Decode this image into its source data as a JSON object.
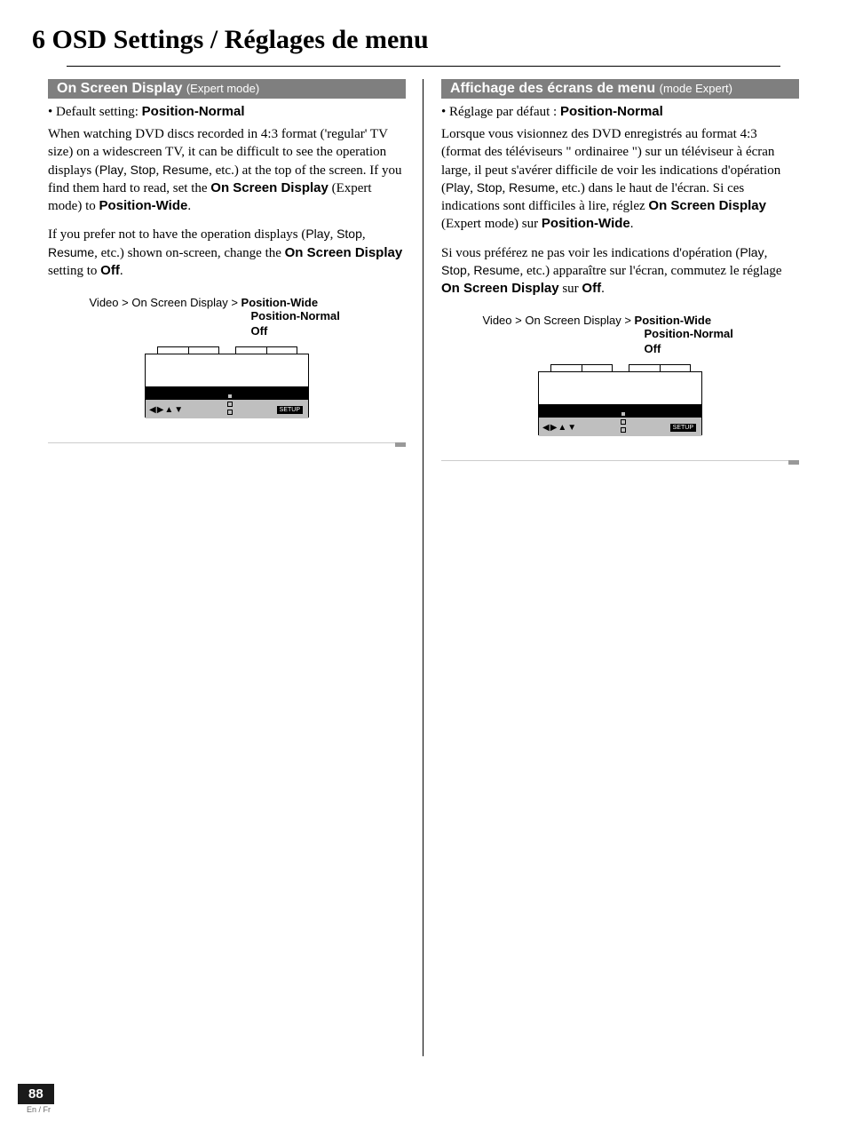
{
  "chapter": "6 OSD Settings / Réglages de menu",
  "en": {
    "bar_main": "On Screen Display",
    "bar_suffix": "(Expert mode)",
    "default_prefix": "• Default setting: ",
    "default_value": "Position-Normal",
    "p1a": "When watching DVD discs recorded in 4:3 format ('regular' TV size) on a widescreen TV, it can be difficult to see the operation displays (",
    "p1_play": "Play",
    "p1b": ", ",
    "p1_stop": "Stop",
    "p1c": ", ",
    "p1_resume": "Resume",
    "p1d": ", etc.) at the top of the screen. If you find them hard to read, set the ",
    "p1_osd": "On Screen Display",
    "p1e": " (Expert mode) to ",
    "p1_pw": "Position-Wide",
    "p1f": ".",
    "p2a": "If you prefer not to have the operation displays (",
    "p2_play": "Play",
    "p2b": ", ",
    "p2_stop": "Stop",
    "p2c": ", ",
    "p2_resume": "Resume",
    "p2d": ", etc.) shown on-screen, change the ",
    "p2_osd": "On Screen Display",
    "p2e": " setting to ",
    "p2_off": "Off",
    "p2f": ".",
    "fig_path_pre": "Video > On Screen Display > ",
    "fig_opt1": "Position-Wide",
    "fig_opt2": "Position-Normal",
    "fig_opt3": "Off",
    "fig_setup": "SETUP"
  },
  "fr": {
    "bar_main": "Affichage des écrans de menu",
    "bar_suffix": "(mode Expert)",
    "default_prefix": "• Réglage par défaut : ",
    "default_value": "Position-Normal",
    "p1a": "Lorsque vous visionnez des DVD enregistrés au format 4:3 (format des téléviseurs \" ordinairee \") sur un téléviseur à écran large, il peut s'avérer difficile de voir les indications d'opération (",
    "p1_play": "Play",
    "p1b": ", ",
    "p1_stop": "Stop",
    "p1c": ", ",
    "p1_resume": "Resume",
    "p1d": ", etc.) dans le haut de l'écran. Si ces indications sont difficiles à lire, réglez ",
    "p1_osd": "On Screen Display",
    "p1e": " (Expert mode) sur ",
    "p1_pw": "Position-Wide",
    "p1f": ".",
    "p2a": "Si vous préférez ne pas voir les indications d'opération (",
    "p2_play": "Play",
    "p2b": ", ",
    "p2_stop": "Stop",
    "p2c": ", ",
    "p2_resume": "Resume",
    "p2d": ", etc.) apparaître sur l'écran, commutez le réglage ",
    "p2_osd": "On Screen Display",
    "p2e": " sur ",
    "p2_off": "Off",
    "p2f": ".",
    "fig_path_pre": "Video > On Screen Display > ",
    "fig_opt1": "Position-Wide",
    "fig_opt2": "Position-Normal",
    "fig_opt3": "Off",
    "fig_setup": "SETUP"
  },
  "footer": {
    "page": "88",
    "lang": "En / Fr"
  }
}
